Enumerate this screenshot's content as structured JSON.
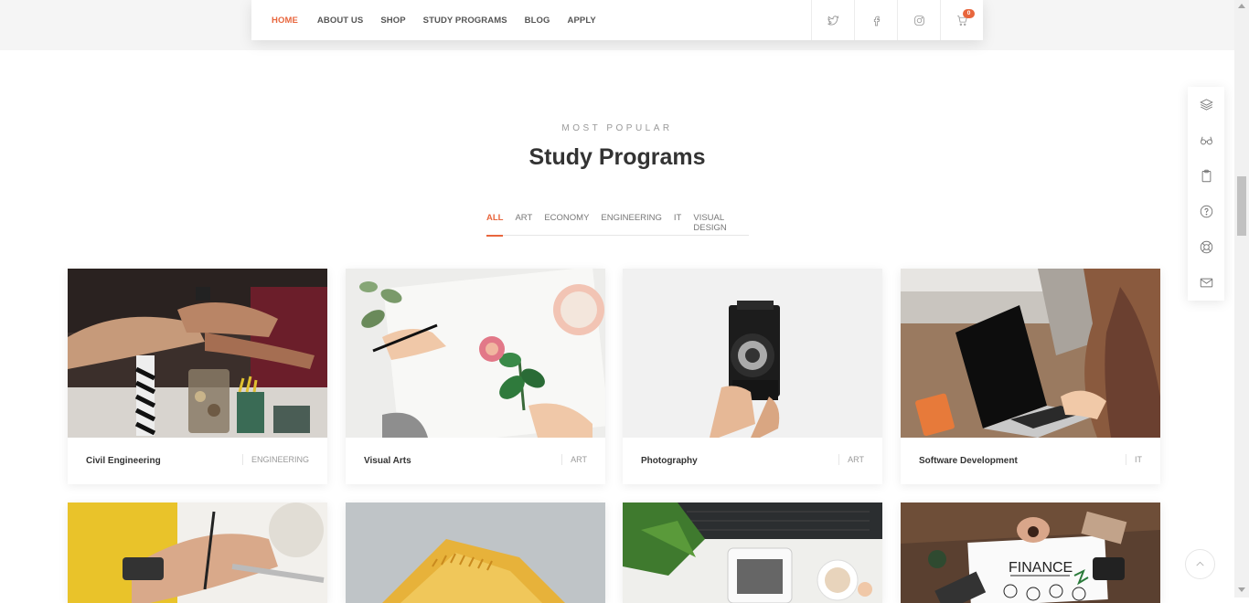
{
  "nav": {
    "links": [
      "HOME",
      "ABOUT US",
      "SHOP",
      "STUDY PROGRAMS",
      "BLOG",
      "APPLY"
    ],
    "active_index": 0,
    "cart_count": "0"
  },
  "section": {
    "eyebrow": "MOST POPULAR",
    "title": "Study Programs"
  },
  "filters": {
    "items": [
      "ALL",
      "ART",
      "ECONOMY",
      "ENGINEERING",
      "IT",
      "VISUAL DESIGN"
    ],
    "active_index": 0
  },
  "programs": [
    {
      "title": "Civil Engineering",
      "category": "ENGINEERING"
    },
    {
      "title": "Visual Arts",
      "category": "ART"
    },
    {
      "title": "Photography",
      "category": "ART"
    },
    {
      "title": "Software Development",
      "category": "IT"
    }
  ],
  "row2_images": {
    "finance_text": "FINANCE"
  },
  "colors": {
    "accent": "#e8663d",
    "text_dark": "#333333",
    "text_muted": "#999999"
  }
}
